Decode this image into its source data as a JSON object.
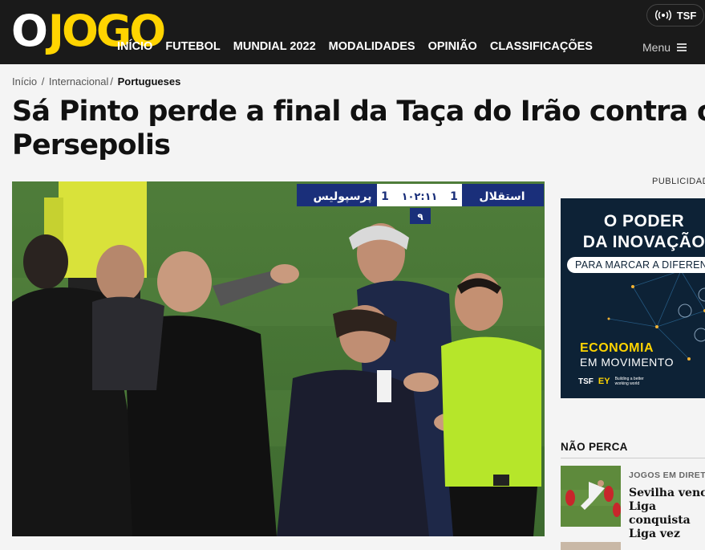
{
  "header": {
    "logo": {
      "o": "O",
      "jogo": "JOGO"
    },
    "nav": [
      "INÍCIO",
      "FUTEBOL",
      "MUNDIAL 2022",
      "MODALIDADES",
      "OPINIÃO",
      "CLASSIFICAÇÕES"
    ],
    "radio_label": "TSF",
    "menu_label": "Menu"
  },
  "breadcrumb": {
    "home": "Início",
    "section": "Internacional",
    "current": "Portugueses"
  },
  "article": {
    "title": "Sá Pinto perde a final da Taça do Irão contra o Persepolis",
    "scoreboard": {
      "home_team": "استقلال",
      "home_score": "1",
      "time": "١٠٢:١١",
      "away_score": "1",
      "away_team": "پرسپولیس",
      "extra": "٩"
    }
  },
  "sidebar": {
    "ad_label": "PUBLICIDADE",
    "ad": {
      "headline_1": "O PODER",
      "headline_2": "DA INOVAÇÃO",
      "pill": "PARA MARCAR A DIFERENÇA",
      "eco": "ECONOMIA",
      "movimento": "EM MOVIMENTO",
      "brand_1": "TSF",
      "brand_2": "EY",
      "brand_tagline": "Building a better working world"
    },
    "nao_perca": {
      "heading": "NÃO PERCA",
      "category": "JOGOS EM DIRETO",
      "title": "Sevilha vence Liga conquista Liga vez"
    }
  },
  "colors": {
    "header_bg": "#1a1a1a",
    "brand_yellow": "#ffd400",
    "ad_bg": "#0d2236",
    "page_bg": "#f4f4f4"
  }
}
